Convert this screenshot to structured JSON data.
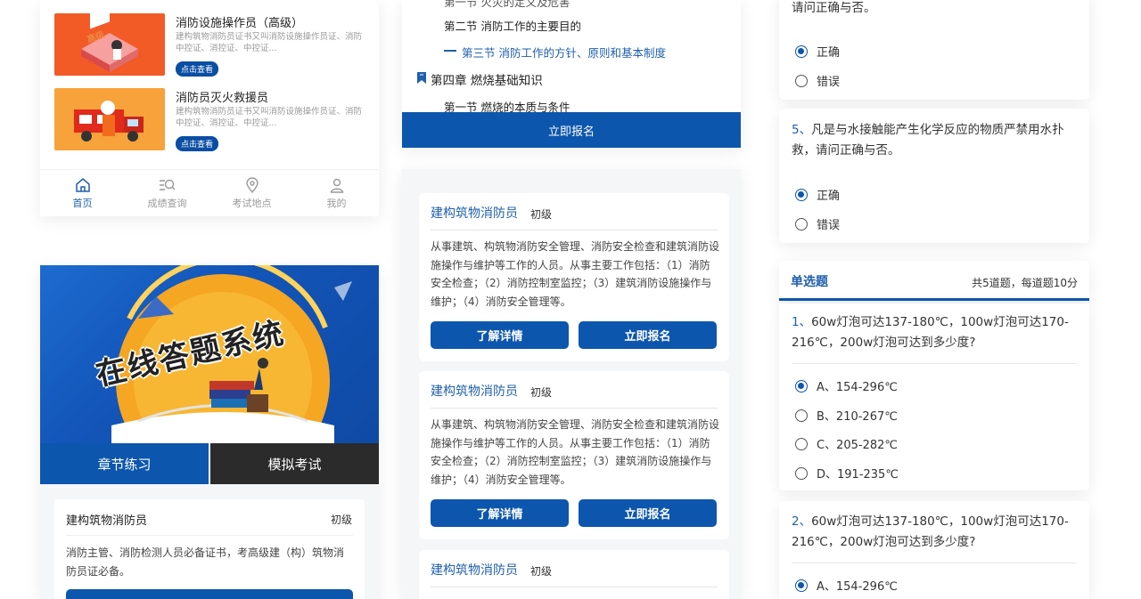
{
  "courses": [
    {
      "title": "消防设施操作员（高级）",
      "desc": "建构筑物消防员证书又叫消防设施操作员证、消防中控证、消控证、中控证...",
      "button": "点击查看",
      "thumb_label": "高级"
    },
    {
      "title": "消防员灭火救援员",
      "desc": "建构筑物消防员证书又叫消防设施操作员证、消防中控证、消控证、中控证...",
      "button": "点击查看"
    }
  ],
  "tabbar": [
    {
      "label": "首页",
      "icon": "home-icon",
      "active": true
    },
    {
      "label": "成绩查询",
      "icon": "search-list-icon",
      "active": false
    },
    {
      "label": "考试地点",
      "icon": "location-icon",
      "active": false
    },
    {
      "label": "我的",
      "icon": "user-icon",
      "active": false
    }
  ],
  "banner": {
    "title": "在线答题系统"
  },
  "modes": {
    "practice": "章节练习",
    "exam": "模拟考试"
  },
  "job_card": {
    "title": "建构筑物消防员",
    "level": "初级",
    "desc": "消防主管、消防检测人员必备证书，考高级建（构）筑物消防员证必备。"
  },
  "toc": {
    "section2": "第二节  消防工作的主要目的",
    "section3": "第三节  消防工作的方针、原则和基本制度",
    "chapter4": "第四章  燃烧基础知识",
    "ch4_section1": "第一节  燃烧的本质与条件",
    "enroll": "立即报名"
  },
  "programs": [
    {
      "title": "建构筑物消防员",
      "level": "初级",
      "desc": "从事建筑、构筑物消防安全管理、消防安全检查和建筑消防设施操作与维护等工作的人员。从事主要工作包括：（1）消防安全检查；（2）消防控制室监控；（3）建筑消防设施操作与维护；（4）消防安全管理等。",
      "detail_btn": "了解详情",
      "enroll_btn": "立即报名"
    },
    {
      "title": "建构筑物消防员",
      "level": "初级",
      "desc": "从事建筑、构筑物消防安全管理、消防安全检查和建筑消防设施操作与维护等工作的人员。从事主要工作包括：（1）消防安全检查；（2）消防控制室监控；（3）建筑消防设施操作与维护；（4）消防安全管理等。",
      "detail_btn": "了解详情",
      "enroll_btn": "立即报名"
    },
    {
      "title": "建构筑物消防员",
      "level": "初级"
    }
  ],
  "tf_questions": {
    "q4_tail": "请问正确与否。",
    "q5_num": "5、",
    "q5_text": "凡是与水接触能产生化学反应的物质严禁用水扑救，请问正确与否。",
    "opt_true": "正确",
    "opt_false": "错误"
  },
  "single_choice": {
    "header": "单选题",
    "summary": "共5道题，每道题10分",
    "q1_num": "1、",
    "q1_text": "60w灯泡可达137-180℃，100w灯泡可达170-216℃，200w灯泡可达到多少度?",
    "q2_num": "2、",
    "q2_text": "60w灯泡可达137-180℃，100w灯泡可达170-216℃，200w灯泡可达到多少度?",
    "options": [
      "A、154-296℃",
      "B、210-267℃",
      "C、205-282℃",
      "D、191-235℃"
    ]
  },
  "colors": {
    "primary": "#0d56ad",
    "link": "#1f5fae",
    "dark": "#2b2b2b"
  }
}
